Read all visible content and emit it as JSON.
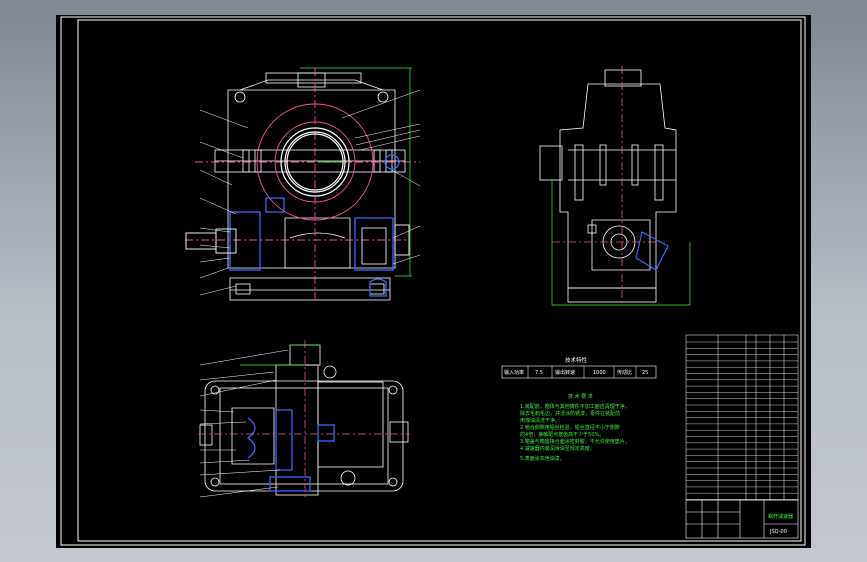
{
  "colors": {
    "background": "#000000",
    "frame": "#ffffff",
    "part": "#ffffff",
    "centerline": "#ff4aa0",
    "dimension": "#3cf23c",
    "section": "#3a68ff",
    "leader": "#ffffff",
    "hatch": "#4a6cff",
    "notes": "#3cf23c"
  },
  "spec_table": {
    "title": "技术特性",
    "cells": [
      "输入功率",
      "7.5",
      "输出转速",
      "1000",
      "传动比",
      "25"
    ]
  },
  "notes": {
    "heading": "技 术 要 求",
    "lines": [
      "1.装配前，箱体与其他铸件不加工面应清理干净，",
      "除去毛刺毛边，并浸涂防锈漆，零件在装配前",
      "用煤油清洗干净。",
      "2.啮合侧隙用铅丝检验，铅丝直径不小于侧隙",
      "的4倍，接触斑点按齿高不少于50%。",
      "3.箱盖与箱座接合面涂密封胶，不允许使用垫片。",
      "4.减速器内装润滑油至规定高度。",
      "5.表面涂灰色油漆。"
    ]
  },
  "title_block": {
    "drawing_name": "蜗杆减速器",
    "drawing_no": "JSQ-00"
  }
}
